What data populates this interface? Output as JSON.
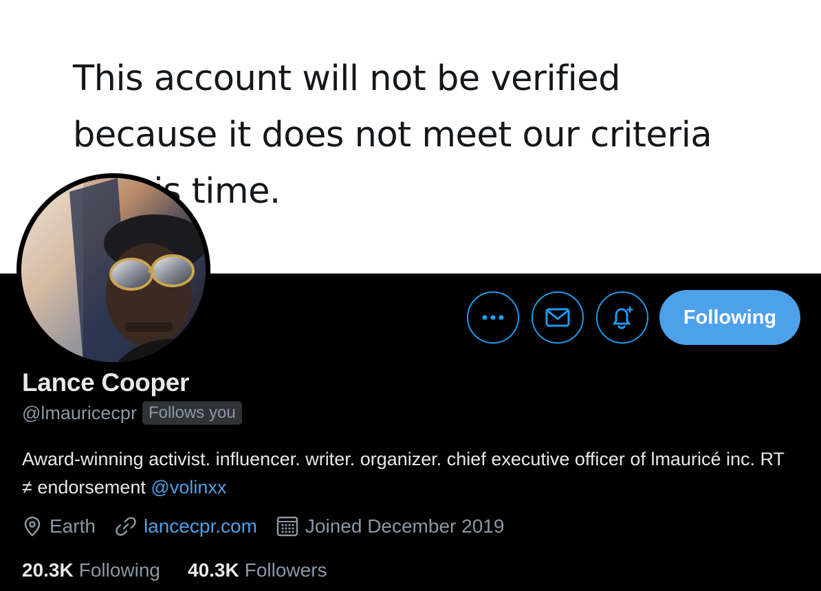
{
  "banner": {
    "line1": "This account will not be verified",
    "line2": "because it does not meet our criteria",
    "line3": "at this time."
  },
  "profile": {
    "name": "Lance Cooper",
    "handle": "@lmauricecpr",
    "follows_you": "Follows you",
    "bio_text": "Award-winning activist. influencer. writer. organizer. chief executive officer of lmauricé inc. RT ≠ endorsement ",
    "bio_mention": "@volinxx",
    "location": "Earth",
    "website": "lancecpr.com",
    "joined": "Joined December 2019"
  },
  "actions": {
    "more_icon": "more-dots-icon",
    "message_icon": "envelope-icon",
    "notify_icon": "bell-plus-icon",
    "following_label": "Following"
  },
  "stats": {
    "following_count": "20.3K",
    "following_label": "Following",
    "followers_count": "40.3K",
    "followers_label": "Followers"
  },
  "colors": {
    "accent": "#4da1eb",
    "background": "#000000",
    "banner": "#ffffff",
    "muted_text": "#8b98a5"
  }
}
